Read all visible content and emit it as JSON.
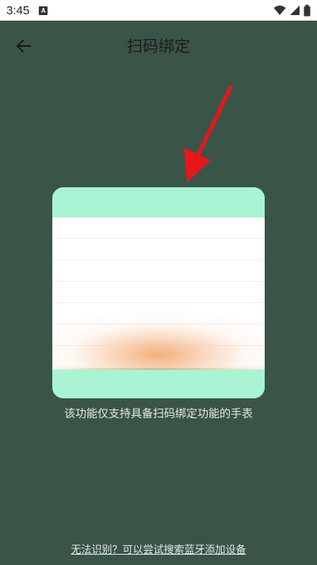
{
  "status_bar": {
    "time": "3:45",
    "notification_icon": "A",
    "icons": [
      "wifi-icon",
      "signal-icon",
      "battery-icon"
    ]
  },
  "app_bar": {
    "title": "扫码绑定",
    "back_icon": "arrow-left-icon"
  },
  "scanner": {
    "hint": "该功能仅支持具备扫码绑定功能的手表"
  },
  "footer": {
    "alt_link": "无法识别？可以尝试搜索蓝牙添加设备"
  },
  "colors": {
    "background": "#3a5548",
    "frame_accent": "#a8f4d5",
    "arrow": "#e8161b",
    "text_light": "#e3e9e5"
  }
}
